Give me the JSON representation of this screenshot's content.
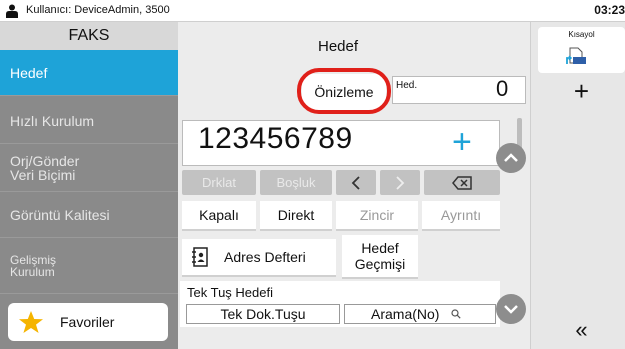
{
  "status_bar": {
    "user_text": "Kullanıcı: DeviceAdmin, 3500",
    "clock": "03:23"
  },
  "left_panel": {
    "title": "FAKS",
    "items": [
      {
        "label": "Hedef",
        "active": true
      },
      {
        "label": "Hızlı Kurulum"
      },
      {
        "label": "Orj/Gönder\nVeri Biçimi"
      },
      {
        "label": "Görüntü Kalitesi"
      },
      {
        "label": "Gelişmiş\nKurulum"
      }
    ],
    "favorites_label": "Favoriler"
  },
  "center": {
    "title": "Hedef",
    "preview_label": "Önizleme",
    "dest_label": "Hed.",
    "dest_count": "0",
    "number": "123456789",
    "keys": {
      "pause": "Drklat",
      "space": "Boşluk"
    },
    "options": [
      "Kapalı",
      "Direkt",
      "Zincir",
      "Ayrıntı"
    ],
    "address_book_label": "Adres Defteri",
    "history_line1": "Hedef",
    "history_line2": "Geçmişi",
    "one_touch_title": "Tek Tuş Hedefi",
    "one_touch_key_label": "Tek Dok.Tuşu",
    "search_label": "Arama(No)"
  },
  "right_panel": {
    "shortcut_title": "Kısayol",
    "add_symbol": "+",
    "collapse_symbol": "«"
  },
  "icons": {
    "user": "user-icon",
    "star": "star-icon",
    "address_book": "address-book-icon",
    "backspace": "backspace-icon",
    "search": "search-icon",
    "shortcut": "shortcut-file-icon"
  },
  "colors": {
    "accent_blue": "#1ea3d8",
    "highlight_red": "#e0201a",
    "star_yellow": "#f5b400"
  }
}
